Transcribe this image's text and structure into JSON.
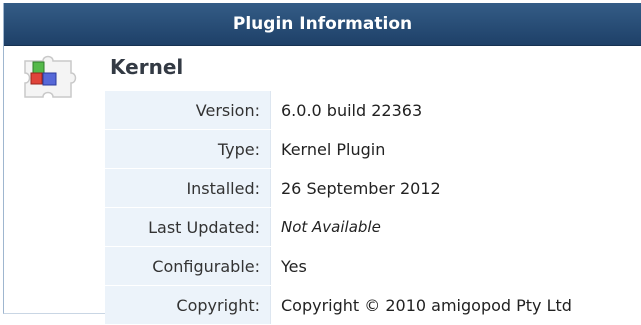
{
  "header": {
    "title": "Plugin Information"
  },
  "plugin": {
    "icon": "puzzle-piece-blocks-icon",
    "name": "Kernel"
  },
  "details": {
    "version": {
      "label": "Version:",
      "value": "6.0.0 build 22363"
    },
    "type": {
      "label": "Type:",
      "value": "Kernel Plugin"
    },
    "installed": {
      "label": "Installed:",
      "value": "26 September 2012"
    },
    "last_updated": {
      "label": "Last Updated:",
      "value": "Not Available"
    },
    "configurable": {
      "label": "Configurable:",
      "value": "Yes"
    },
    "copyright": {
      "label": "Copyright:",
      "value": "Copyright © 2010 amigopod Pty Ltd"
    }
  },
  "colors": {
    "header_bg": "#2a4f78",
    "header_text": "#ffffff",
    "label_bg": "#ecf3fa"
  }
}
